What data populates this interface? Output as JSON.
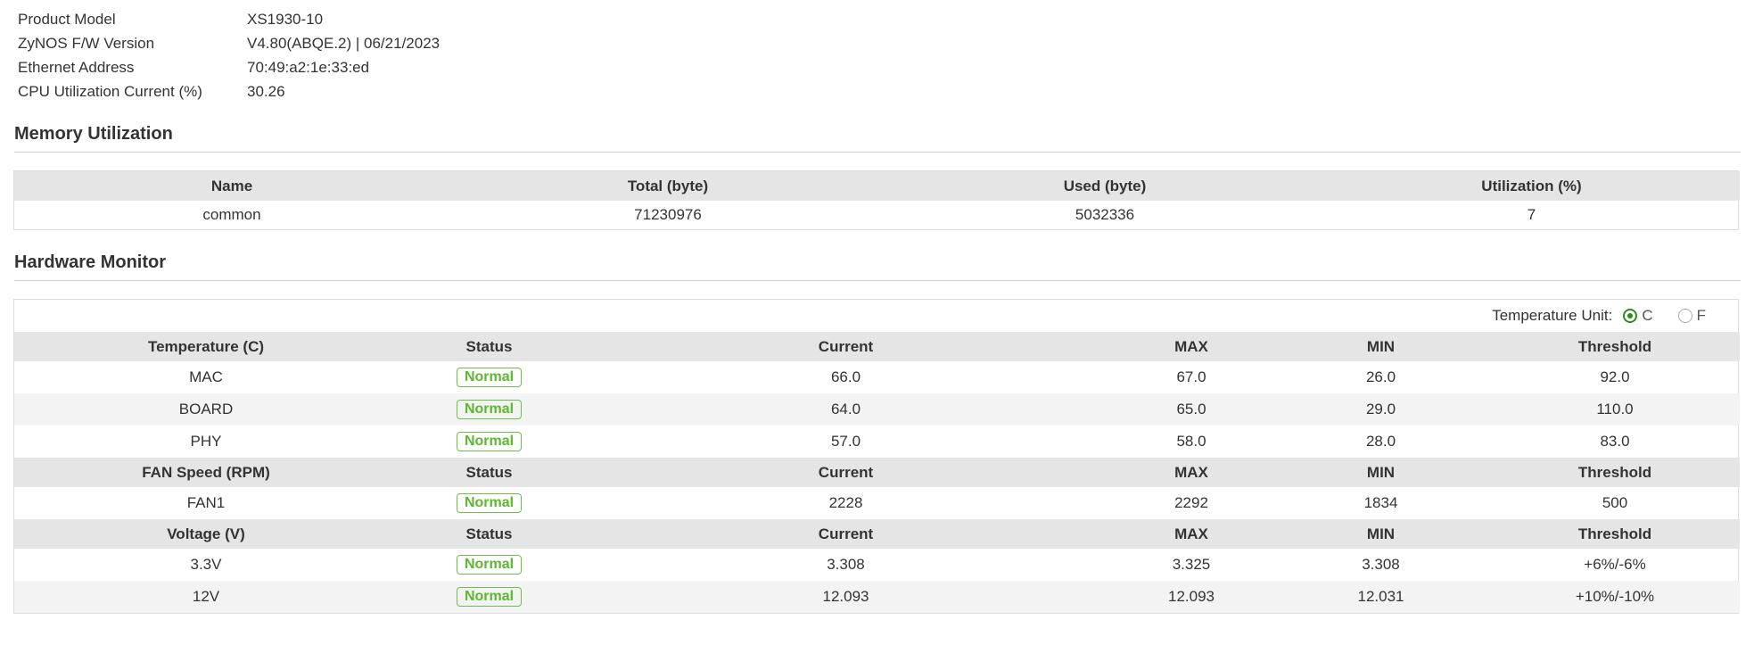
{
  "info": [
    {
      "label": "Product Model",
      "value": "XS1930-10"
    },
    {
      "label": "ZyNOS F/W Version",
      "value": "V4.80(ABQE.2) | 06/21/2023"
    },
    {
      "label": "Ethernet Address",
      "value": "70:49:a2:1e:33:ed"
    },
    {
      "label": "CPU Utilization Current (%)",
      "value": "30.26"
    }
  ],
  "memory": {
    "title": "Memory Utilization",
    "headers": [
      "Name",
      "Total (byte)",
      "Used (byte)",
      "Utilization (%)"
    ],
    "rows": [
      [
        "common",
        "71230976",
        "5032336",
        "7"
      ]
    ]
  },
  "hardware": {
    "title": "Hardware Monitor",
    "unit_label": "Temperature Unit:",
    "unit_options": [
      {
        "label": "C",
        "selected": true
      },
      {
        "label": "F",
        "selected": false
      }
    ],
    "status_headers": [
      "Status",
      "Current",
      "MAX",
      "MIN",
      "Threshold"
    ],
    "groups": [
      {
        "title": "Temperature (C)",
        "rows": [
          {
            "name": "MAC",
            "status": "Normal",
            "current": "66.0",
            "max": "67.0",
            "min": "26.0",
            "threshold": "92.0"
          },
          {
            "name": "BOARD",
            "status": "Normal",
            "current": "64.0",
            "max": "65.0",
            "min": "29.0",
            "threshold": "110.0"
          },
          {
            "name": "PHY",
            "status": "Normal",
            "current": "57.0",
            "max": "58.0",
            "min": "28.0",
            "threshold": "83.0"
          }
        ]
      },
      {
        "title": "FAN Speed (RPM)",
        "rows": [
          {
            "name": "FAN1",
            "status": "Normal",
            "current": "2228",
            "max": "2292",
            "min": "1834",
            "threshold": "500"
          }
        ]
      },
      {
        "title": "Voltage (V)",
        "rows": [
          {
            "name": "3.3V",
            "status": "Normal",
            "current": "3.308",
            "max": "3.325",
            "min": "3.308",
            "threshold": "+6%/-6%"
          },
          {
            "name": "12V",
            "status": "Normal",
            "current": "12.093",
            "max": "12.093",
            "min": "12.031",
            "threshold": "+10%/-10%"
          }
        ]
      }
    ]
  },
  "colors": {
    "status_normal": "#5cb82e",
    "radio_selected": "#2e8b1e",
    "header_bg": "#e5e5e5"
  }
}
